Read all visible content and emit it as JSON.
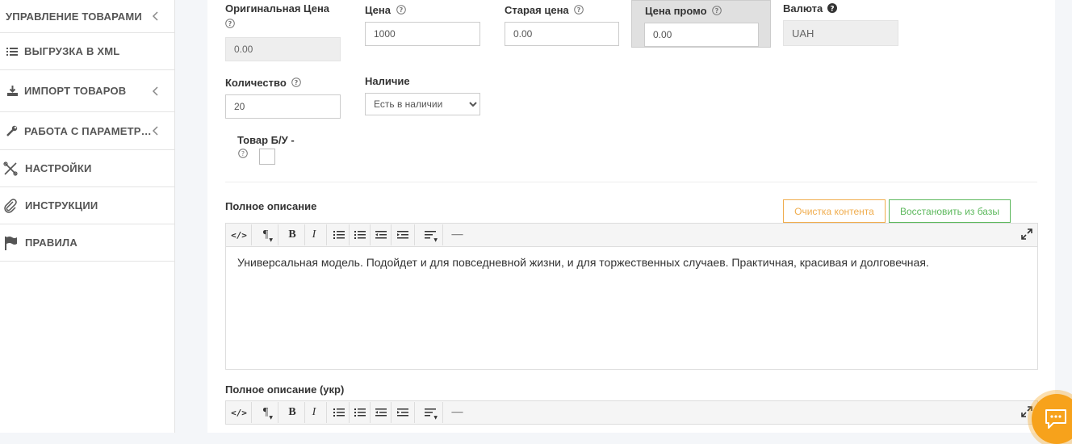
{
  "sidebar": {
    "items": [
      {
        "label": "УПРАВЛЕНИЕ ТОВАРАМИ",
        "icon": "none",
        "has_chevron": true
      },
      {
        "label": "ВЫГРУЗКА В XML",
        "icon": "list-icon",
        "has_chevron": false
      },
      {
        "label": "ИМПОРТ ТОВАРОВ",
        "icon": "download-icon",
        "has_chevron": true
      },
      {
        "label": "РАБОТА С ПАРАМЕТР…",
        "icon": "wrench-icon",
        "has_chevron": true
      },
      {
        "label": "НАСТРОЙКИ",
        "icon": "tools-icon",
        "has_chevron": false
      },
      {
        "label": "ИНСТРУКЦИИ",
        "icon": "paperclip-icon",
        "has_chevron": false
      },
      {
        "label": "ПРАВИЛА",
        "icon": "flag-icon",
        "has_chevron": false
      }
    ]
  },
  "form": {
    "original_price": {
      "label": "Оригинальная Цена",
      "value": "0.00"
    },
    "price": {
      "label": "Цена",
      "value": "1000"
    },
    "old_price": {
      "label": "Старая цена",
      "value": "0.00"
    },
    "promo_price": {
      "label": "Цена промо",
      "value": "0.00"
    },
    "currency": {
      "label": "Валюта",
      "value": "UAH"
    },
    "quantity": {
      "label": "Количество",
      "value": "20"
    },
    "availability": {
      "label": "Наличие",
      "selected": "Есть в наличии"
    },
    "used": {
      "label": "Товар Б/У -",
      "checked": false
    }
  },
  "description": {
    "label": "Полное описание",
    "clear_button": "Очистка контента",
    "restore_button": "Восстановить из базы",
    "text": "Универсальная модель. Подойдет и для повседневной жизни, и для торжественных случаев. Практичная, красивая и долговечная."
  },
  "description_ukr": {
    "label": "Полное описание (укр)"
  },
  "toolbar": {
    "code": "</>",
    "paragraph": "¶",
    "bold": "B",
    "italic": "I",
    "hr": "—"
  },
  "colors": {
    "warning": "#f0ad4e",
    "success": "#5cb85c",
    "chat": "#f7a21b"
  }
}
